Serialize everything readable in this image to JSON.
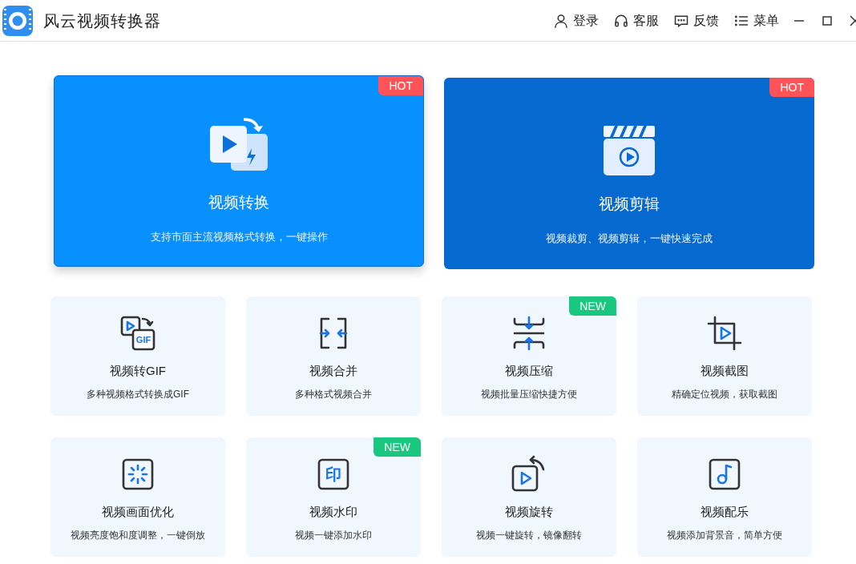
{
  "app": {
    "title": "风云视频转换器"
  },
  "nav": [
    {
      "kind": "user",
      "label": "登录"
    },
    {
      "kind": "headset",
      "label": "客服"
    },
    {
      "kind": "chat",
      "label": "反馈"
    },
    {
      "kind": "menu",
      "label": "菜单"
    }
  ],
  "feature_cards": [
    {
      "kind": "convert",
      "title": "视频转换",
      "description": "支持市面主流视频格式转换，一键操作",
      "badge": "HOT",
      "selected": true
    },
    {
      "kind": "edit",
      "title": "视频剪辑",
      "description": "视频裁剪、视频剪辑，一键快速完成",
      "badge": "HOT",
      "selected": false
    }
  ],
  "tools": [
    {
      "kind": "gif",
      "icon_text": "GIF",
      "title": "视频转GIF",
      "description": "多种视频格式转换成GIF"
    },
    {
      "kind": "merge",
      "title": "视频合并",
      "description": "多种格式视频合并"
    },
    {
      "kind": "compress",
      "title": "视频压缩",
      "description": "视频批量压缩快捷方便",
      "badge": "NEW"
    },
    {
      "kind": "crop",
      "title": "视频截图",
      "description": "精确定位视频，获取截图"
    },
    {
      "kind": "enhance",
      "title": "视频画面优化",
      "description": "视频亮度饱和度调整，一键倒放"
    },
    {
      "kind": "watermark",
      "icon_text": "印",
      "title": "视频水印",
      "description": "视频一键添加水印",
      "badge": "NEW"
    },
    {
      "kind": "rotate",
      "title": "视频旋转",
      "description": "视频一键旋转，镜像翻转"
    },
    {
      "kind": "music",
      "title": "视频配乐",
      "description": "视频添加背景音，简单方便"
    }
  ]
}
